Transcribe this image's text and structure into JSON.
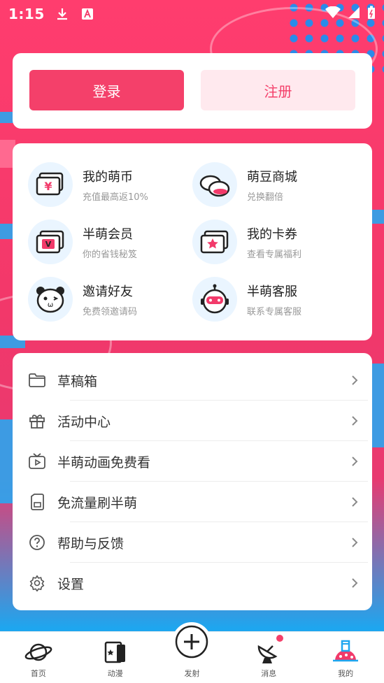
{
  "status_bar": {
    "time": "1:15"
  },
  "auth": {
    "login_label": "登录",
    "register_label": "注册"
  },
  "features": [
    {
      "title": "我的萌币",
      "subtitle": "充值最高返10%",
      "icon": "coin-ticket-icon"
    },
    {
      "title": "萌豆商城",
      "subtitle": "兑换翻倍",
      "icon": "beans-icon"
    },
    {
      "title": "半萌会员",
      "subtitle": "你的省钱秘笈",
      "icon": "vip-card-icon"
    },
    {
      "title": "我的卡券",
      "subtitle": "查看专属福利",
      "icon": "coupon-star-icon"
    },
    {
      "title": "邀请好友",
      "subtitle": "免费领邀请码",
      "icon": "panda-face-icon"
    },
    {
      "title": "半萌客服",
      "subtitle": "联系专属客服",
      "icon": "robot-icon"
    }
  ],
  "menu": [
    {
      "label": "草稿箱",
      "icon": "folder-icon"
    },
    {
      "label": "活动中心",
      "icon": "gift-icon"
    },
    {
      "label": "半萌动画免费看",
      "icon": "tv-play-icon"
    },
    {
      "label": "免流量刷半萌",
      "icon": "sim-card-icon"
    },
    {
      "label": "帮助与反馈",
      "icon": "help-circle-icon"
    },
    {
      "label": "设置",
      "icon": "gear-icon"
    }
  ],
  "tabbar": [
    {
      "label": "首页",
      "icon": "planet-icon"
    },
    {
      "label": "动漫",
      "icon": "comic-book-icon"
    },
    {
      "label": "发射",
      "icon": "plus-circle-icon"
    },
    {
      "label": "消息",
      "icon": "satellite-dish-icon"
    },
    {
      "label": "我的",
      "icon": "rocket-base-icon"
    }
  ],
  "colors": {
    "accent": "#f4406a",
    "accent_light": "#ffe9ee",
    "blue": "#1ea6ef"
  }
}
